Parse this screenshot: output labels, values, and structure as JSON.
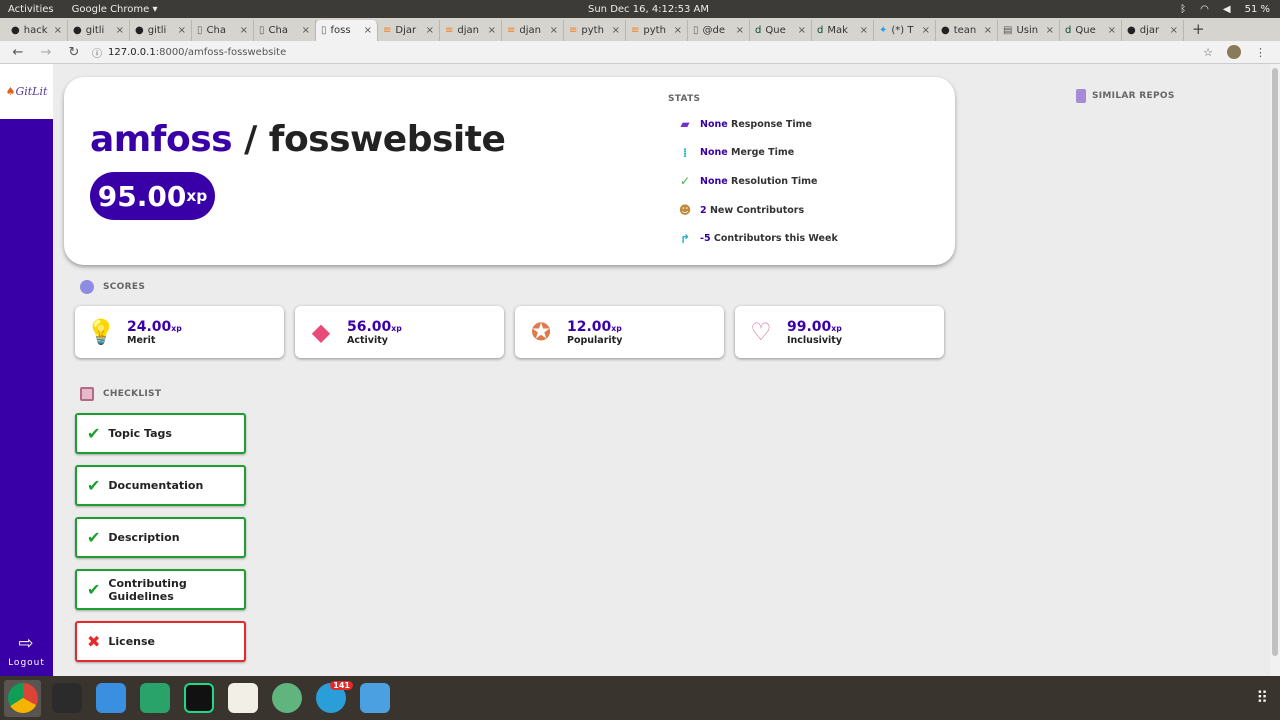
{
  "system": {
    "activities": "Activities",
    "app_menu": "Google Chrome ▾",
    "clock": "Sun Dec 16,  4:12:53 AM",
    "battery": "51 %",
    "dock_badge": "141"
  },
  "browser": {
    "tabs": [
      {
        "label": "hack",
        "icon": "github-icon"
      },
      {
        "label": "gitli",
        "icon": "github-icon"
      },
      {
        "label": "gitli",
        "icon": "github-icon"
      },
      {
        "label": "Cha",
        "icon": "page-icon"
      },
      {
        "label": "Cha",
        "icon": "page-icon"
      },
      {
        "label": "foss",
        "icon": "page-icon",
        "active": true
      },
      {
        "label": "Djar",
        "icon": "stackoverflow-icon"
      },
      {
        "label": "djan",
        "icon": "stackoverflow-icon"
      },
      {
        "label": "djan",
        "icon": "stackoverflow-icon"
      },
      {
        "label": "pyth",
        "icon": "stackoverflow-icon"
      },
      {
        "label": "pyth",
        "icon": "stackoverflow-icon"
      },
      {
        "label": "@de",
        "icon": "page-icon"
      },
      {
        "label": "Que",
        "icon": "django-icon"
      },
      {
        "label": "Mak",
        "icon": "django-icon"
      },
      {
        "label": "(*) T",
        "icon": "twitter-icon"
      },
      {
        "label": "tean",
        "icon": "github-icon"
      },
      {
        "label": "Usin",
        "icon": "doc-icon"
      },
      {
        "label": "Que",
        "icon": "django-icon"
      },
      {
        "label": "djar",
        "icon": "github-icon"
      }
    ],
    "url_host": "127.0.0.1",
    "url_rest": ":8000/amfoss-fosswebsite"
  },
  "sidebar": {
    "logo": "GitLit",
    "logout": "Logout"
  },
  "repo": {
    "org": "amfoss",
    "separator": " / ",
    "name": "fosswebsite",
    "xp": "95.00",
    "xp_unit": "xp"
  },
  "stats": {
    "label": "STATS",
    "items": [
      {
        "value": "None",
        "text": "Response Time",
        "icon": "response-icon"
      },
      {
        "value": "None",
        "text": "Merge Time",
        "icon": "merge-icon"
      },
      {
        "value": "None",
        "text": "Resolution Time",
        "icon": "check-circle-icon"
      },
      {
        "value": "2",
        "text": "New Contributors",
        "icon": "user-add-icon"
      },
      {
        "value": "-5",
        "text": "Contributors this Week",
        "icon": "trend-icon"
      }
    ]
  },
  "similar": {
    "label": "SIMILAR REPOS"
  },
  "scores": {
    "label": "SCORES",
    "items": [
      {
        "value": "24.00",
        "unit": "xp",
        "name": "Merit",
        "icon": "lightbulb-icon"
      },
      {
        "value": "56.00",
        "unit": "xp",
        "name": "Activity",
        "icon": "flowchart-icon"
      },
      {
        "value": "12.00",
        "unit": "xp",
        "name": "Popularity",
        "icon": "star-badge-icon"
      },
      {
        "value": "99.00",
        "unit": "xp",
        "name": "Inclusivity",
        "icon": "handshake-icon"
      }
    ]
  },
  "checklist": {
    "label": "CHECKLIST",
    "items": [
      {
        "name": "Topic Tags",
        "ok": true
      },
      {
        "name": "Documentation",
        "ok": true
      },
      {
        "name": "Description",
        "ok": true
      },
      {
        "name": "Contributing Guidelines",
        "ok": true
      },
      {
        "name": "License",
        "ok": false
      }
    ]
  },
  "colors": {
    "brand": "#3a00a8",
    "pass": "#1d9e2f",
    "fail": "#e52a2a"
  }
}
